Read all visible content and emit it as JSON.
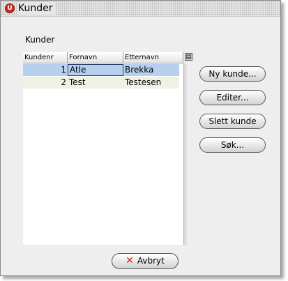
{
  "window": {
    "title": "Kunder",
    "app_icon": "app-logo-icon"
  },
  "panel": {
    "label": "Kunder"
  },
  "table": {
    "columns": [
      "Kundenr",
      "Fornavn",
      "Etternavn"
    ],
    "rows": [
      {
        "kundenr": "1",
        "fornavn": "Atle",
        "etternavn": "Brekka",
        "selected": true
      },
      {
        "kundenr": "2",
        "fornavn": "Test",
        "etternavn": "Testesen",
        "selected": false
      }
    ],
    "column_chooser_icon": "column-chooser-icon"
  },
  "actions": {
    "new": "Ny kunde...",
    "edit": "Editer...",
    "delete": "Slett kunde",
    "search": "Søk..."
  },
  "footer": {
    "cancel": "Avbryt",
    "cancel_icon": "close-x-icon"
  },
  "colors": {
    "selection": "#b7d0ef",
    "alt_row": "#f0f1e4",
    "app_icon": "#cc2a1f",
    "cancel_icon": "#d0241b"
  }
}
